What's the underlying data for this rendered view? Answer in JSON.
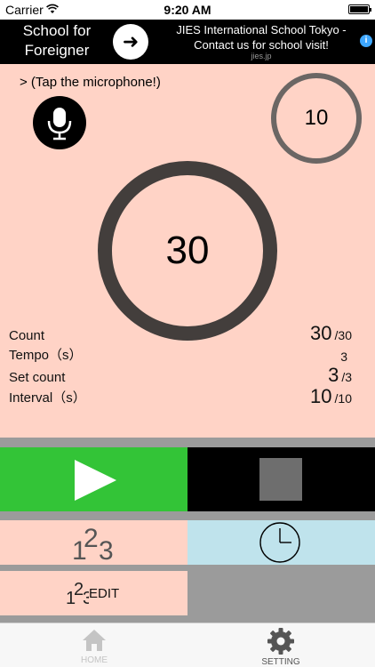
{
  "status_bar": {
    "carrier": "Carrier",
    "time": "9:20 AM"
  },
  "ad": {
    "left_text": "School for Foreigner",
    "text": "JIES International School Tokyo - Contact us for school visit!",
    "domain": "jies.jp",
    "info": "i"
  },
  "prompt": ">  (Tap the microphone!)",
  "timer": {
    "small_ring": "10",
    "big_ring": "30"
  },
  "stats": [
    {
      "label": "Count",
      "current": "30",
      "total": "/30"
    },
    {
      "label": "Tempo（s）",
      "current": "3",
      "total": ""
    },
    {
      "label": "Set count",
      "current": "3",
      "total": "/3"
    },
    {
      "label": "Interval（s）",
      "current": "10",
      "total": "/10"
    }
  ],
  "controls": {
    "edit_label": "EDIT"
  },
  "tabs": [
    {
      "label": "HOME",
      "icon": "home-icon"
    },
    {
      "label": "SETTING",
      "icon": "gear-icon"
    }
  ],
  "colors": {
    "background": "#ffd3c6",
    "play": "#33c437",
    "stop": "#000000",
    "clock_button": "#bfe3ec",
    "ring_big": "#433e3c",
    "ring_small": "#6b6664"
  }
}
